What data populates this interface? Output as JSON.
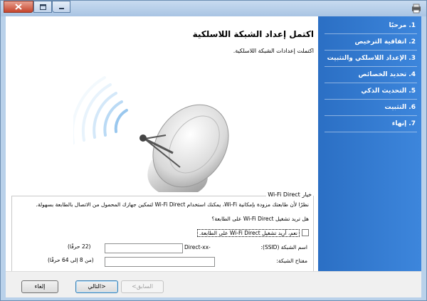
{
  "steps": [
    "1. مرحبًا",
    "2. اتفاقية الترخيص",
    "3. الإعداد اللاسلكي والتثبيت",
    "4. تحديد الخصائص",
    "5. التحديث الذكي",
    "6. التثبيت",
    "7. إنهاء"
  ],
  "title": "اكتمل إعداد الشبكة اللاسلكية",
  "subtitle": "اكتملت إعدادات الشبكة اللاسلكية.",
  "wifi_direct": {
    "group_label": "خيار Wi-Fi Direct",
    "description": "نظرًا لأن طابعتك مزودة بإمكانية Wi-Fi، يمكنك استخدام Wi-Fi Direct لتمكين جهازك المحمول من الاتصال بالطابعة بسهولة.",
    "question": "هل تريد تشغيل Wi-Fi Direct على الطابعة؟",
    "checkbox_label": "نعم، أريد تشغيل Wi-Fi Direct على الطابعة.",
    "ssid_label": "اسم الشبكة (SSID):",
    "ssid_prefix": "Direct-xx-",
    "ssid_hint": "(22 حرفًا)",
    "key_label": "مفتاح الشبكة:",
    "key_hint": "(من 8 إلى 64 حرفًا)"
  },
  "buttons": {
    "cancel": "إلغاء",
    "next": "التالي>",
    "back": "<السابق"
  }
}
